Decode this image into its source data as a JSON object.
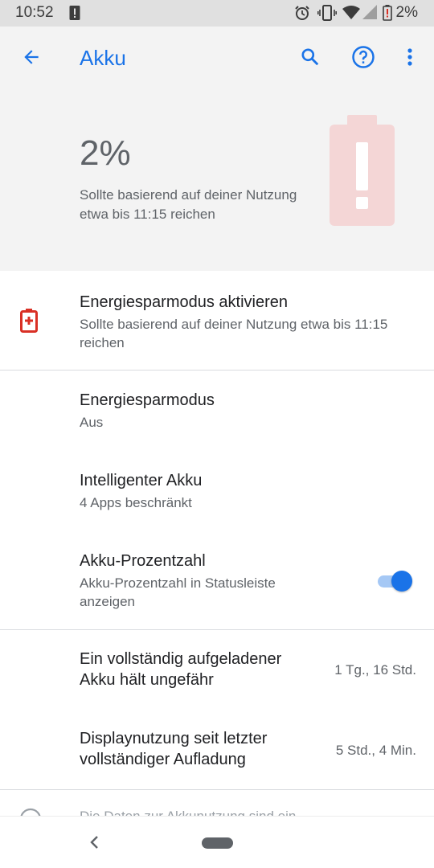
{
  "status_bar": {
    "time": "10:52",
    "battery_percent": "2%",
    "icons": [
      "alert-icon",
      "alarm-icon",
      "vibrate-icon",
      "wifi-icon",
      "signal-icon",
      "battery-icon"
    ]
  },
  "toolbar": {
    "title": "Akku",
    "icons": [
      "back-arrow-icon",
      "search-icon",
      "help-icon",
      "more-vert-icon"
    ]
  },
  "hero": {
    "level": "2%",
    "estimate": "Sollte basierend auf deiner Nutzung etwa bis 11:15 reichen"
  },
  "suggestion": {
    "title": "Energiesparmodus aktivieren",
    "summary": "Sollte basierend auf deiner Nutzung etwa bis 11:15 reichen"
  },
  "settings": [
    {
      "title": "Energiesparmodus",
      "summary": "Aus"
    },
    {
      "title": "Intelligenter Akku",
      "summary": "4 Apps beschränkt"
    },
    {
      "title": "Akku-Prozentzahl",
      "summary": "Akku-Prozentzahl in Statusleiste anzeigen",
      "enabled": true
    }
  ],
  "usage": [
    {
      "title": "Ein vollständig aufgeladener Akku hält ungefähr",
      "value": "1 Tg., 16 Std."
    },
    {
      "title": "Displaynutzung seit letzter vollständiger Aufladung",
      "value": "5 Std., 4 Min."
    }
  ],
  "footer_peek": "Die Daten zur Akkunutzung sind ein",
  "colors": {
    "accent": "#1a73e8",
    "warning": "#d93025",
    "hero_bg": "#f3f3f3"
  }
}
